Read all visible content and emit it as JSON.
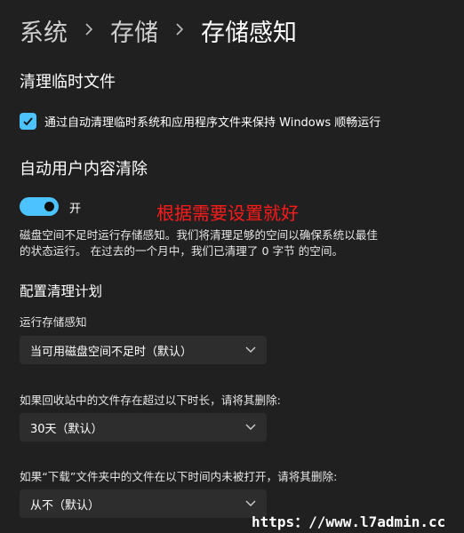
{
  "breadcrumb": {
    "items": [
      "系统",
      "存储",
      "存储感知"
    ]
  },
  "cleanup_temp": {
    "title": "清理临时文件",
    "checkbox_label": "通过自动清理临时系统和应用程序文件来保持 Windows 顺畅运行",
    "checked": true
  },
  "auto_cleanup": {
    "title": "自动用户内容清除",
    "toggle_label": "开",
    "toggle_on": true,
    "description_lines": [
      "磁盘空间不足时运行存储感知。我们将清理足够的空间以确保系统以最佳",
      "的状态运行。 在过去的一个月中，我们已清理了 0 字节 的空间。"
    ]
  },
  "annotation": {
    "text": "根据需要设置就好",
    "color": "#ff1a1a"
  },
  "schedule": {
    "title": "配置清理计划",
    "run_label": "运行存储感知",
    "run_value": "当可用磁盘空间不足时（默认）",
    "recycle_label": "如果回收站中的文件存在超过以下时长，请将其删除:",
    "recycle_value": "30天（默认）",
    "downloads_label": "如果“下载”文件夹中的文件在以下时间内未被打开，请将其删除:",
    "downloads_value": "从不（默认）"
  },
  "watermark": "https：//www.l7admin.cc",
  "colors": {
    "background": "#202020",
    "accent": "#4cc2ff",
    "dropdown_bg": "#2d2d2d"
  },
  "icons": {
    "separator": "chevron-right-icon",
    "dropdown": "chevron-down-icon",
    "checkbox": "checkmark-icon"
  }
}
